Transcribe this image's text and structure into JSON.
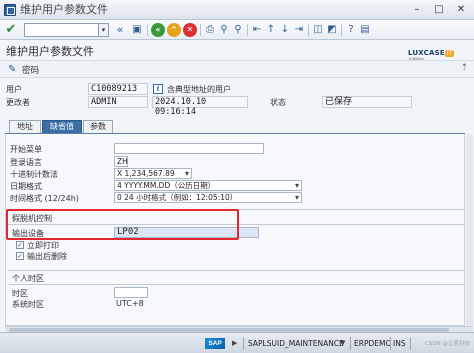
{
  "window": {
    "title": "维护用户参数文件",
    "minimize": "–",
    "maximize": "□",
    "close": "✕"
  },
  "toolbar": {
    "command_value": "",
    "save": "保存",
    "back": "返回",
    "exit": "退出",
    "cancel": "取消"
  },
  "page": {
    "title": "维护用户参数文件"
  },
  "appbar": {
    "password_label": "密码"
  },
  "logo": {
    "brand": "LUXCASE",
    "badge": "IT",
    "sub": "立恩科技"
  },
  "header": {
    "user_label": "用户",
    "user_value": "C10089213",
    "user_type_text": "含典型地址的用户",
    "changed_by_label": "更改者",
    "changed_by_value": "ADMIN",
    "changed_at_value": "2024.10.10 09:16:14",
    "status_label": "状态",
    "status_value": "已保存"
  },
  "tabs": [
    {
      "label": "地址",
      "active": false
    },
    {
      "label": "缺省值",
      "active": true
    },
    {
      "label": "参数",
      "active": false
    }
  ],
  "defaults": {
    "start_menu_label": "开始菜单",
    "start_menu_value": "",
    "logon_lang_label": "登录语言",
    "logon_lang_value": "ZH",
    "decimal_label": "十进制计数法",
    "decimal_value": "X 1,234,567.89",
    "date_fmt_label": "日期格式",
    "date_fmt_value": "4 YYYY.MM.DD（公历日期）",
    "time_fmt_label": "时间格式 (12/24h)",
    "time_fmt_value": "0 24 小时格式（例如：12:05:10）"
  },
  "spool": {
    "group_title": "假脱机控制",
    "output_device_label": "输出设备",
    "output_device_value": "LP02",
    "print_now_label": "立即打印",
    "print_now_checked": true,
    "delete_after_label": "输出后删除",
    "delete_after_checked": true
  },
  "timezone": {
    "group_title": "个人时区",
    "tz_label": "时区",
    "tz_value": "",
    "sys_tz_label": "系统时区",
    "sys_tz_value": "UTC+8"
  },
  "status": {
    "sap": "SAP",
    "transaction": "SAPLSUID_MAINTENANCE",
    "system": "ERPDEMO",
    "mode": "INS"
  },
  "watermark": "CSDN @立恩科技"
}
